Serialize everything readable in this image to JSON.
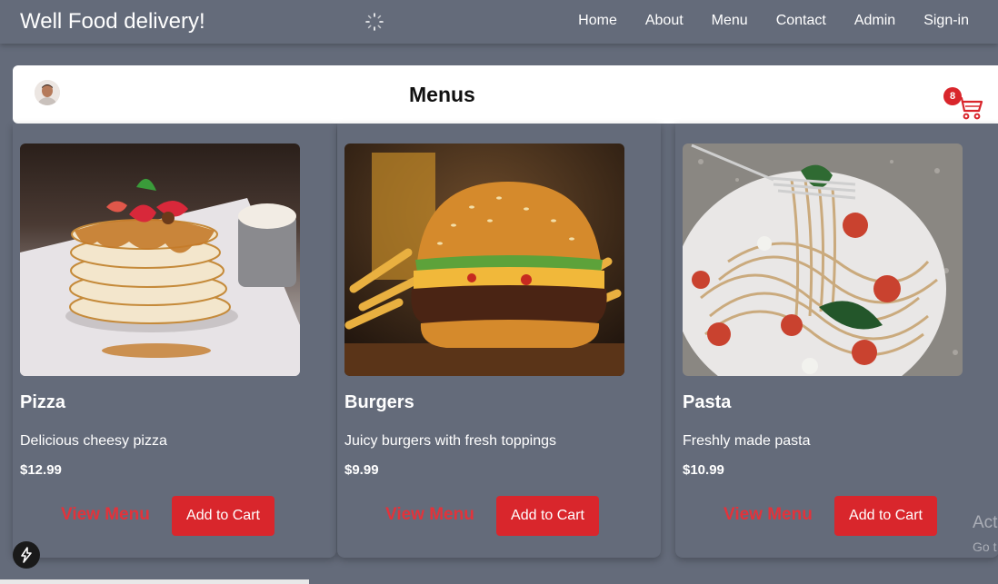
{
  "navbar": {
    "brand": "Well Food delivery!",
    "spinner_icon": "loading-spinner-icon",
    "links": [
      "Home",
      "About",
      "Menu",
      "Contact",
      "Admin",
      "Sign-in"
    ]
  },
  "menus_bar": {
    "title": "Menus",
    "avatar_icon": "user-avatar",
    "cart_count": "8",
    "cart_icon": "shopping-cart-icon"
  },
  "items": [
    {
      "name": "Pizza",
      "description": "Delicious cheesy pizza",
      "price": "$12.99",
      "view_label": "View Menu",
      "add_label": "Add to Cart"
    },
    {
      "name": "Burgers",
      "description": "Juicy burgers with fresh toppings",
      "price": "$9.99",
      "view_label": "View Menu",
      "add_label": "Add to Cart"
    },
    {
      "name": "Pasta",
      "description": "Freshly made pasta",
      "price": "$10.99",
      "view_label": "View Menu",
      "add_label": "Add to Cart"
    }
  ],
  "overlay": {
    "bolt_icon": "lightning-bolt-icon",
    "watermark_line1": "Act",
    "watermark_line2": "Go t"
  },
  "colors": {
    "background": "#646b7a",
    "accent_red": "#d9262c",
    "view_menu_red": "#e2333b"
  }
}
